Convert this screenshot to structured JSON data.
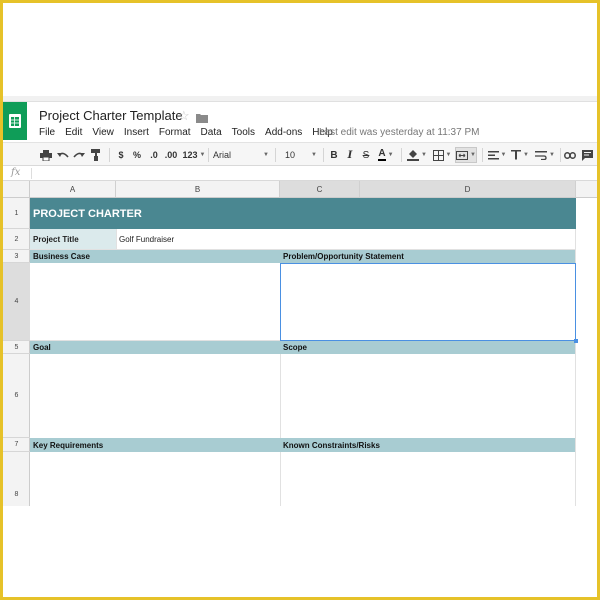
{
  "app": {
    "doc_title": "Project Charter Template",
    "icons": {
      "logo": "sheets-logo-icon",
      "star": "star-icon",
      "folder": "folder-icon"
    },
    "menu": [
      "File",
      "Edit",
      "View",
      "Insert",
      "Format",
      "Data",
      "Tools",
      "Add-ons",
      "Help"
    ],
    "last_edit": "Last edit was yesterday at 11:37 PM",
    "colors": {
      "brand": "#0f9d58",
      "title_band": "#4a8791",
      "header_band": "#a8ccd2",
      "label_cell": "#dbeaec",
      "selection": "#4a90e2"
    }
  },
  "toolbar": {
    "currency": "$",
    "percent": "%",
    "dec_less": ".0",
    "dec_more": ".00",
    "more_formats": "123",
    "font": "Arial",
    "size": "10",
    "bold": "B",
    "italic": "I",
    "strike": "S",
    "text_color": "A",
    "icons": [
      "print-icon",
      "undo-icon",
      "redo-icon",
      "paint-format-icon",
      "fill-color-icon",
      "borders-icon",
      "merge-icon",
      "align-left-icon",
      "valign-top-icon",
      "wrap-icon",
      "link-icon",
      "comment-icon"
    ]
  },
  "formula_bar": {
    "label": "fx",
    "value": ""
  },
  "columns": [
    "A",
    "B",
    "C",
    "D"
  ],
  "rows": [
    "1",
    "2",
    "3",
    "4",
    "5",
    "6",
    "7",
    "8"
  ],
  "sheet": {
    "title": "PROJECT CHARTER",
    "project_title_label": "Project Title",
    "project_title_value": "Golf Fundraiser",
    "business_case": "Business Case",
    "problem_statement": "Problem/Opportunity Statement",
    "goal": "Goal",
    "scope": "Scope",
    "key_requirements": "Key Requirements",
    "constraints": "Known Constraints/Risks"
  }
}
